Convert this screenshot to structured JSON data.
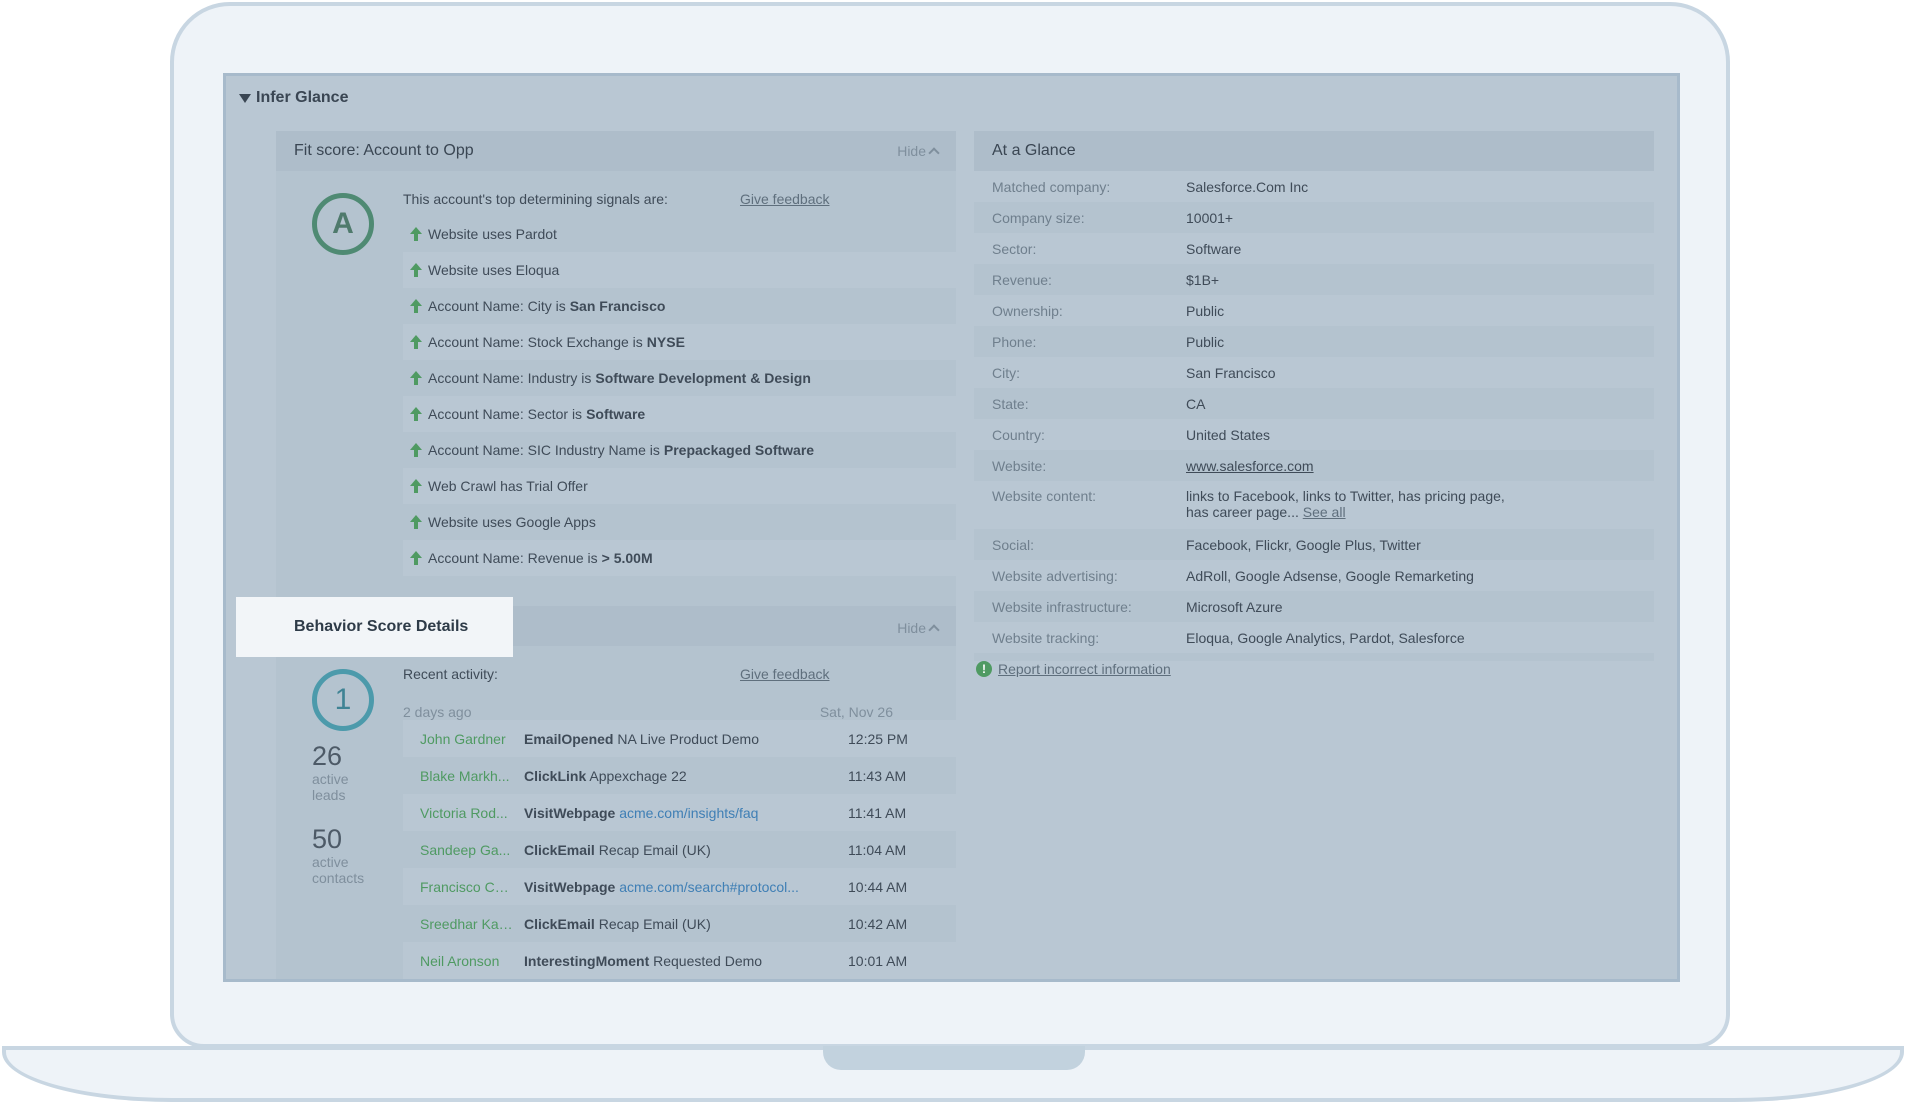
{
  "app": {
    "title": "Infer Glance"
  },
  "fit": {
    "title": "Fit score: Account to Opp",
    "hide_label": "Hide",
    "grade": "A",
    "intro": "This account's top determining signals are:",
    "feedback_label": "Give feedback",
    "signals": [
      {
        "text": "Website uses Pardot",
        "bold": ""
      },
      {
        "text": "Website uses Eloqua",
        "bold": ""
      },
      {
        "text": "Account Name: City is",
        "bold": "San Francisco"
      },
      {
        "text": "Account Name: Stock Exchange is",
        "bold": "NYSE"
      },
      {
        "text": "Account Name: Industry is",
        "bold": "Software Development & Design"
      },
      {
        "text": "Account Name: Sector is",
        "bold": "Software"
      },
      {
        "text": "Account Name: SIC Industry Name is",
        "bold": "Prepackaged Software"
      },
      {
        "text": "Web Crawl has Trial Offer",
        "bold": ""
      },
      {
        "text": "Website uses Google Apps",
        "bold": ""
      },
      {
        "text": "Account Name: Revenue is",
        "bold": "> 5.00M"
      }
    ]
  },
  "behavior": {
    "title": "Behavior Score Details",
    "hide_label": "Hide",
    "score": "1",
    "active_leads": {
      "n": "26",
      "label1": "active",
      "label2": "leads"
    },
    "active_contacts": {
      "n": "50",
      "label1": "active",
      "label2": "contacts"
    },
    "recent_label": "Recent activity:",
    "feedback_label": "Give feedback",
    "day_ago": "2 days ago",
    "day_date": "Sat, Nov 26",
    "activities": [
      {
        "who": "John Gardner",
        "action": "EmailOpened",
        "detail": "NA Live Product Demo",
        "link": "",
        "time": "12:25 PM"
      },
      {
        "who": "Blake Markh...",
        "action": "ClickLink",
        "detail": "Appexchage 22",
        "link": "",
        "time": "11:43 AM"
      },
      {
        "who": "Victoria Rod...",
        "action": "VisitWebpage",
        "detail": "",
        "link": "acme.com/insights/faq",
        "time": "11:41 AM"
      },
      {
        "who": "Sandeep Ga...",
        "action": "ClickEmail",
        "detail": "Recap Email (UK)",
        "link": "",
        "time": "11:04 AM"
      },
      {
        "who": "Francisco Ca...",
        "action": "VisitWebpage",
        "detail": "",
        "link": "acme.com/search#protocol...",
        "time": "10:44 AM"
      },
      {
        "who": "Sreedhar Kar...",
        "action": "ClickEmail",
        "detail": "Recap Email (UK)",
        "link": "",
        "time": "10:42 AM"
      },
      {
        "who": "Neil Aronson",
        "action": "InterestingMoment",
        "detail": "Requested Demo",
        "link": "",
        "time": "10:01 AM"
      }
    ]
  },
  "glance": {
    "title": "At a Glance",
    "rows": [
      {
        "k": "Matched company:",
        "v": "Salesforce.Com Inc"
      },
      {
        "k": "Company size:",
        "v": "10001+"
      },
      {
        "k": "Sector:",
        "v": "Software"
      },
      {
        "k": "Revenue:",
        "v": "$1B+"
      },
      {
        "k": "Ownership:",
        "v": "Public"
      },
      {
        "k": "Phone:",
        "v": "Public"
      },
      {
        "k": "City:",
        "v": "San Francisco"
      },
      {
        "k": "State:",
        "v": "CA"
      },
      {
        "k": "Country:",
        "v": "United States"
      },
      {
        "k": "Website:",
        "v": "www.salesforce.com",
        "link": true
      },
      {
        "k": "Website content:",
        "v": "links to Facebook, links to Twitter, has pricing page, has career page...",
        "see": "See all"
      },
      {
        "k": "Social:",
        "v": "Facebook, Flickr, Google Plus, Twitter"
      },
      {
        "k": "Website advertising:",
        "v": "AdRoll, Google Adsense, Google Remarketing"
      },
      {
        "k": "Website infrastructure:",
        "v": "Microsoft Azure"
      },
      {
        "k": "Website tracking:",
        "v": "Eloqua, Google Analytics, Pardot, Salesforce"
      }
    ],
    "report_label": "Report incorrect information"
  },
  "colors": {
    "positive": "#4f9a62",
    "link": "#3f7fb5",
    "fit_ring": "#4f8a73",
    "behavior_ring": "#4c9aab"
  }
}
